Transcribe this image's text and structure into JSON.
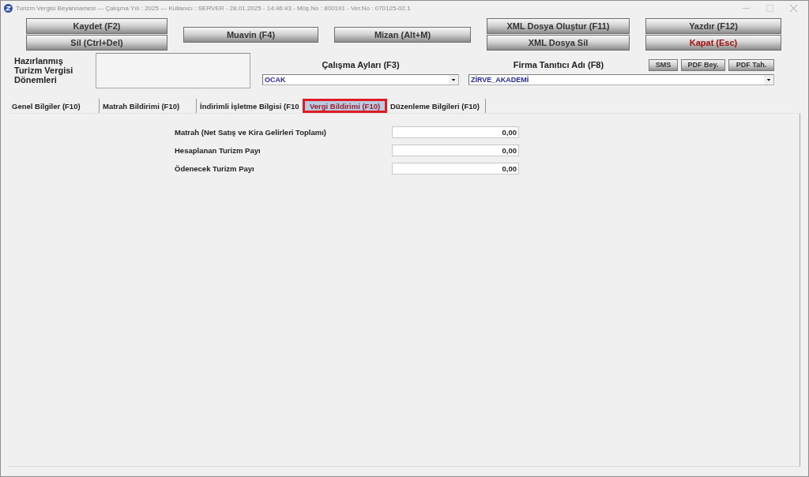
{
  "window": {
    "title": "Turizm Vergisi Beyannamesi --- Çalışma Yılı : 2025 --- Kullanıcı : SERVER - 28.01.2025 - 14:46:43 - Müş.No : 800191 - Ver.No : 070125-02.1"
  },
  "toolbar": [
    {
      "buttons": [
        {
          "label": "Kaydet (F2)",
          "kind": "default"
        },
        {
          "label": "Sil (Ctrl+Del)",
          "kind": "default"
        }
      ]
    },
    {
      "buttons": [
        {
          "label": "Muavin (F4)",
          "kind": "default"
        }
      ]
    },
    {
      "buttons": [
        {
          "label": "Mizan (Alt+M)",
          "kind": "default"
        }
      ]
    },
    {
      "buttons": [
        {
          "label": "XML Dosya Oluştur (F11)",
          "kind": "default"
        },
        {
          "label": "XML Dosya Sil",
          "kind": "default"
        }
      ]
    },
    {
      "buttons": [
        {
          "label": "Yazdır (F12)",
          "kind": "default"
        },
        {
          "label": "Kapat (Esc)",
          "kind": "exit"
        }
      ]
    }
  ],
  "periods": {
    "label": "Hazırlanmış Turizm Vergisi Dönemleri"
  },
  "work_months": {
    "label": "Çalışma Ayları (F3)",
    "value": "OCAK"
  },
  "company": {
    "label": "Firma Tanıtıcı Adı (F8)",
    "value": "ZİRVE_AKADEMİ",
    "buttons": [
      "SMS",
      "PDF Bey.",
      "PDF Tah."
    ]
  },
  "tabs": [
    {
      "label": "Genel Bilgiler (F10)",
      "selected": false,
      "highlighted": false
    },
    {
      "label": "Matrah Bildirimi (F10)",
      "selected": false,
      "highlighted": false
    },
    {
      "label": "İndirimli İşletme Bilgisi (F10",
      "selected": false,
      "highlighted": false
    },
    {
      "label": "Vergi Bildirimi (F10)",
      "selected": true,
      "highlighted": true
    },
    {
      "label": "Düzenleme Bilgileri (F10)",
      "selected": false,
      "highlighted": false
    }
  ],
  "fields": [
    {
      "label": "Matrah (Net Satış ve Kira Gelirleri Toplamı)",
      "value": "0,00"
    },
    {
      "label": "Hesaplanan Turizm Payı",
      "value": "0,00"
    },
    {
      "label": "Ödenecek Turizm Payı",
      "value": "0,00"
    }
  ]
}
